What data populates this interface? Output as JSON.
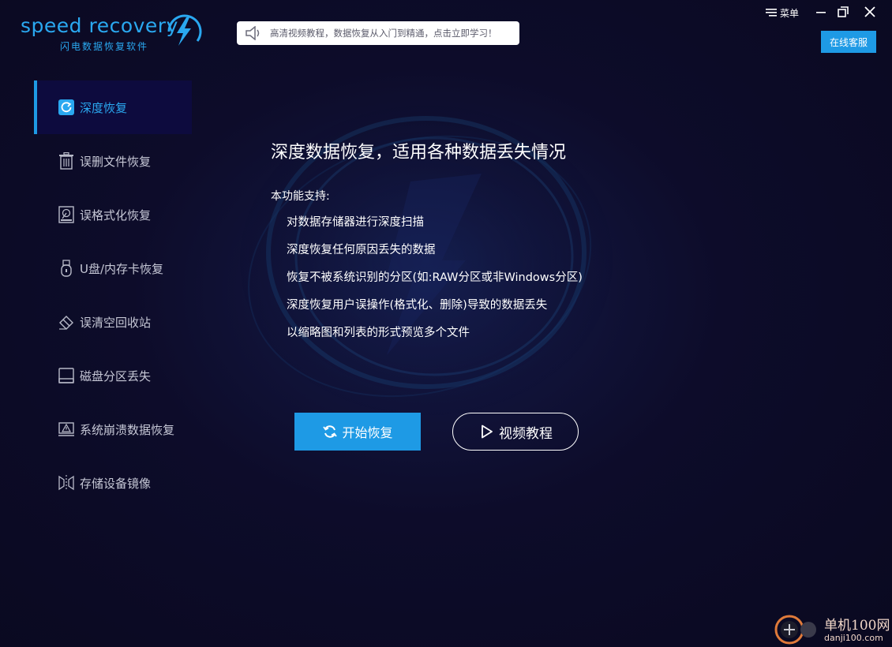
{
  "app": {
    "logo_text": "speed recovery",
    "logo_subtitle": "闪电数据恢复软件",
    "notice_text": "高清视频教程，数据恢复从入门到精通，点击立即学习！",
    "menu_label": "菜单",
    "service_label": "在线客服"
  },
  "sidebar": {
    "items": [
      {
        "label": "深度恢复",
        "icon": "refresh-icon",
        "active": true
      },
      {
        "label": "误删文件恢复",
        "icon": "trash-icon"
      },
      {
        "label": "误格式化恢复",
        "icon": "disk-icon"
      },
      {
        "label": "U盘/内存卡恢复",
        "icon": "usb-icon"
      },
      {
        "label": "误清空回收站",
        "icon": "eraser-icon"
      },
      {
        "label": "磁盘分区丢失",
        "icon": "drive-icon"
      },
      {
        "label": "系统崩溃数据恢复",
        "icon": "alert-monitor-icon"
      },
      {
        "label": "存储设备镜像",
        "icon": "mirror-icon"
      }
    ]
  },
  "main": {
    "title": "深度数据恢复，适用各种数据丢失情况",
    "support_label": "本功能支持:",
    "features": [
      "对数据存储器进行深度扫描",
      "深度恢复任何原因丢失的数据",
      "恢复不被系统识别的分区(如:RAW分区或非Windows分区)",
      "深度恢复用户误操作(格式化、删除)导致的数据丢失",
      "以缩略图和列表的形式预览多个文件"
    ],
    "start_label": "开始恢复",
    "video_label": "视频教程"
  },
  "watermark": {
    "line1": "单机100网",
    "line2": "danji100.com"
  },
  "colors": {
    "accent": "#1e9ae5",
    "background": "#0b0a22",
    "active_item_bg": "#0d0b3e"
  }
}
